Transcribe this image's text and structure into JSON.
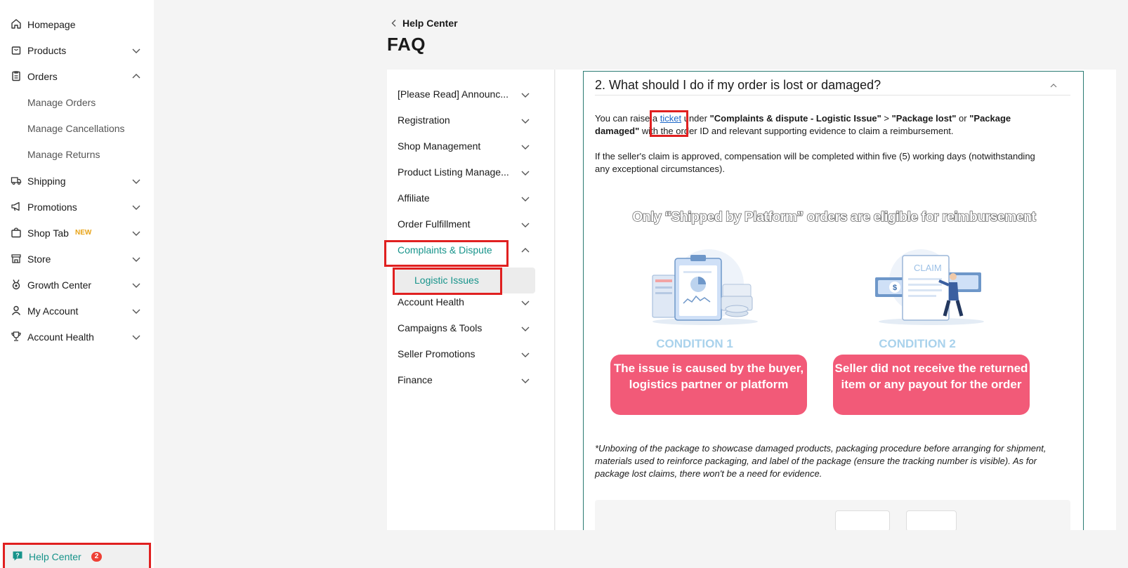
{
  "sidebar": {
    "items": [
      {
        "label": "Homepage",
        "icon": "home-icon"
      },
      {
        "label": "Products",
        "icon": "bag-icon"
      },
      {
        "label": "Orders",
        "icon": "clipboard-icon"
      },
      {
        "label": "Shipping",
        "icon": "truck-icon"
      },
      {
        "label": "Promotions",
        "icon": "megaphone-icon"
      },
      {
        "label": "Shop Tab",
        "icon": "shop-bag-icon",
        "badge": "NEW"
      },
      {
        "label": "Store",
        "icon": "store-icon"
      },
      {
        "label": "Growth Center",
        "icon": "medal-icon"
      },
      {
        "label": "My Account",
        "icon": "user-icon"
      },
      {
        "label": "Account Health",
        "icon": "trophy-icon"
      }
    ],
    "orders_sub": [
      "Manage Orders",
      "Manage Cancellations",
      "Manage Returns"
    ],
    "help_center": {
      "label": "Help Center",
      "badge": "2",
      "icon": "help-chat-icon"
    }
  },
  "header": {
    "back_label": "Help Center",
    "title": "FAQ"
  },
  "faq_categories": [
    "[Please Read] Announc...",
    "Registration",
    "Shop Management",
    "Product Listing Manage...",
    "Affiliate",
    "Order Fulfillment",
    "Complaints & Dispute",
    "Account Health",
    "Campaigns & Tools",
    "Seller Promotions",
    "Finance"
  ],
  "faq_active_sub": "Logistic Issues",
  "article": {
    "question": "2. What should I do if my order is lost or damaged?",
    "p1_a": "You can raise a ",
    "p1_link": "ticket",
    "p1_b": " under ",
    "p1_bold1": "\"Complaints & dispute - Logistic Issue\"",
    "p1_c": " > ",
    "p1_bold2": "\"Package lost\"",
    "p1_d": " or ",
    "p1_bold3": "\"Package damaged\"",
    "p1_e": " with the order ID and relevant supporting evidence to claim a reimbursement.",
    "p2": "If the seller's claim is approved, compensation will be completed within five (5) working days (notwithstanding any exceptional circumstances).",
    "banner_title": "Only “Shipped by Platform” orders are eligible for reimbursement",
    "condition1_title": "CONDITION 1",
    "condition1_text": "The issue is caused by the buyer, logistics partner or platform",
    "condition2_title": "CONDITION 2",
    "condition2_text": "Seller did not receive the returned item or any payout for the order",
    "claim_label": "CLAIM",
    "footnote": "*Unboxing of the package to showcase damaged products, packaging procedure before arranging for shipment, materials used to reinforce packaging, and label of the package (ensure the tracking number is visible). As for package lost claims, there won't be a need for evidence."
  },
  "colors": {
    "accent": "#16938a",
    "highlight_red": "#e02020",
    "condition_pink": "#f25a78",
    "condition_title_blue": "#a9d2ec"
  }
}
